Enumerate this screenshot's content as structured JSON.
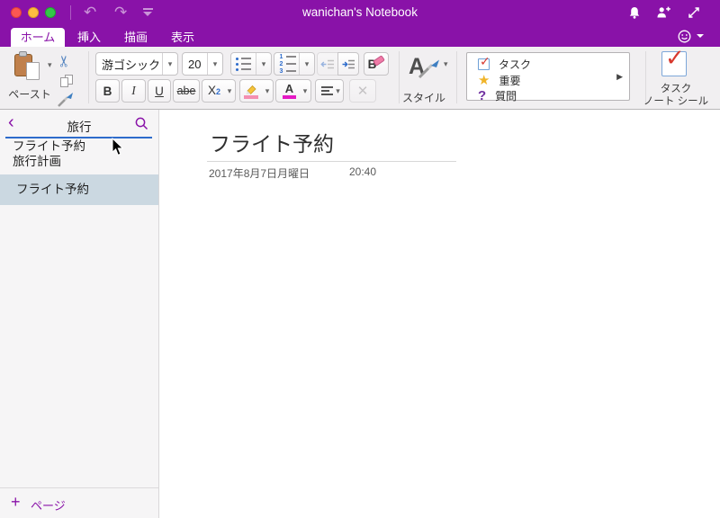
{
  "window": {
    "title": "wanichan's Notebook"
  },
  "tabs": [
    {
      "label": "ホーム",
      "active": true
    },
    {
      "label": "挿入",
      "active": false
    },
    {
      "label": "描画",
      "active": false
    },
    {
      "label": "表示",
      "active": false
    }
  ],
  "ribbon": {
    "paste_label": "ペースト",
    "font_name": "游ゴシック",
    "font_size": "20",
    "bold": "B",
    "italic": "I",
    "underline": "U",
    "strikethrough": "abe",
    "subscript_base": "X",
    "subscript_sub": "2",
    "style_label": "スタイル",
    "tag_items": [
      {
        "label": "タスク",
        "icon": "checkbox-red-check"
      },
      {
        "label": "重要",
        "icon": "yellow-star"
      },
      {
        "label": "質問",
        "icon": "purple-question"
      }
    ],
    "sticker_label_line1": "タスク",
    "sticker_label_line2": "ノート シール"
  },
  "sidebar": {
    "search_value": "旅行",
    "search_results": [
      {
        "label": "フライト予約"
      },
      {
        "label": "旅行計画"
      }
    ],
    "pages": [
      {
        "label": "フライト予約",
        "selected": true
      }
    ],
    "add_page_label": "ページ"
  },
  "content": {
    "page_title": "フライト予約",
    "date": "2017年8月7日月曜日",
    "time": "20:40"
  },
  "icons": {
    "undo": "↶",
    "redo": "↷",
    "scissors": "✂",
    "star": "★",
    "question": "?",
    "flyout": "▶",
    "back": "‹",
    "plus": "+",
    "check": "✓",
    "close": "✕",
    "dropdown": "▾",
    "num1": "1",
    "num2": "2",
    "num3": "3"
  },
  "colors": {
    "titlebar_purple": "#8912A8",
    "focus_blue": "#2D6BCB",
    "selected_row": "#CBD8E1",
    "traffic_red": "#FC5753",
    "traffic_yellow": "#FDBC40",
    "traffic_green": "#33C748"
  }
}
